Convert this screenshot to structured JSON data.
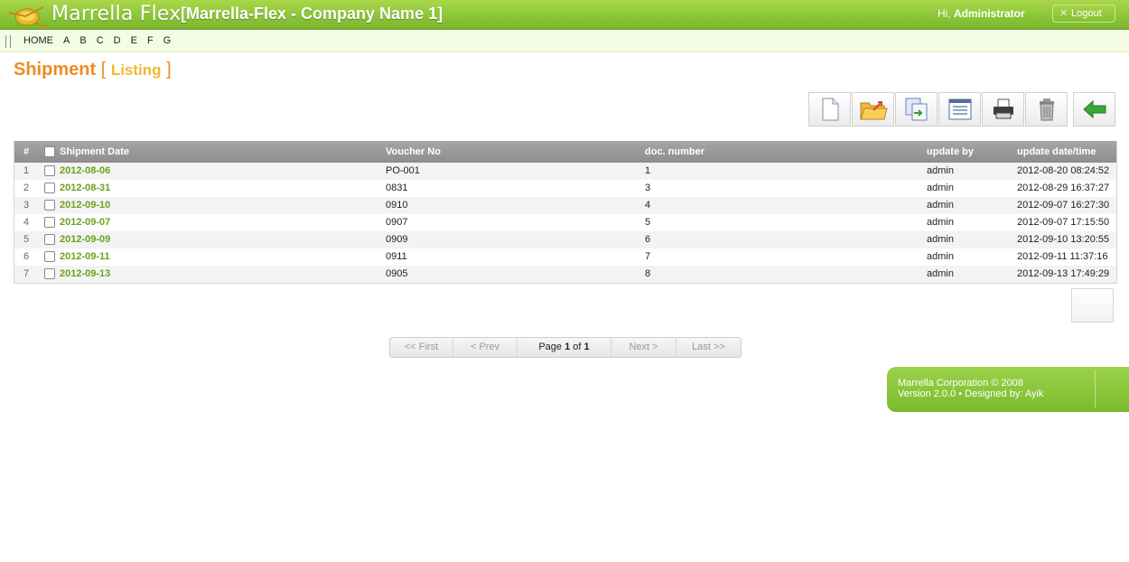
{
  "header": {
    "brand": "Marrella Flex",
    "company": "[Marrella-Flex - Company Name 1]",
    "greeting_prefix": "Hi, ",
    "user": "Administrator",
    "logout_label": "Logout"
  },
  "menu": {
    "items": [
      "HOME",
      "A",
      "B",
      "C",
      "D",
      "E",
      "F",
      "G"
    ]
  },
  "page": {
    "title": "Shipment",
    "bracket_open": "[",
    "subtitle": "Listing",
    "bracket_close": "]"
  },
  "toolbar": {
    "icons": [
      "new-document-icon",
      "open-folder-icon",
      "copy-document-icon",
      "list-view-icon",
      "print-icon",
      "trash-icon",
      "back-arrow-icon"
    ]
  },
  "table": {
    "headers": {
      "num": "#",
      "date": "Shipment Date",
      "voucher": "Voucher No",
      "doc": "doc. number",
      "upby": "update by",
      "updt": "update date/time"
    },
    "rows": [
      {
        "num": "1",
        "date": "2012-08-06",
        "voucher": "PO-001",
        "doc": "1",
        "upby": "admin",
        "updt": "2012-08-20 08:24:52"
      },
      {
        "num": "2",
        "date": "2012-08-31",
        "voucher": "0831",
        "doc": "3",
        "upby": "admin",
        "updt": "2012-08-29 16:37:27"
      },
      {
        "num": "3",
        "date": "2012-09-10",
        "voucher": "0910",
        "doc": "4",
        "upby": "admin",
        "updt": "2012-09-07 16:27:30"
      },
      {
        "num": "4",
        "date": "2012-09-07",
        "voucher": "0907",
        "doc": "5",
        "upby": "admin",
        "updt": "2012-09-07 17:15:50"
      },
      {
        "num": "5",
        "date": "2012-09-09",
        "voucher": "0909",
        "doc": "6",
        "upby": "admin",
        "updt": "2012-09-10 13:20:55"
      },
      {
        "num": "6",
        "date": "2012-09-11",
        "voucher": "0911",
        "doc": "7",
        "upby": "admin",
        "updt": "2012-09-11 11:37:16"
      },
      {
        "num": "7",
        "date": "2012-09-13",
        "voucher": "0905",
        "doc": "8",
        "upby": "admin",
        "updt": "2012-09-13 17:49:29"
      }
    ]
  },
  "pager": {
    "first": "<< First",
    "prev": "< Prev",
    "page_word": "Page ",
    "current": "1",
    "of_word": " of ",
    "total": "1",
    "next": "Next >",
    "last": "Last >>"
  },
  "footer": {
    "line1": "Marrella Corporation © 2008",
    "line2": "Version 2.0.0  •  Designed by: Ayik"
  },
  "colors": {
    "header_green": "#8cc63a",
    "title_orange": "#f08a24",
    "subtitle_yellow": "#f4b732",
    "date_link_green": "#6aa21c"
  }
}
